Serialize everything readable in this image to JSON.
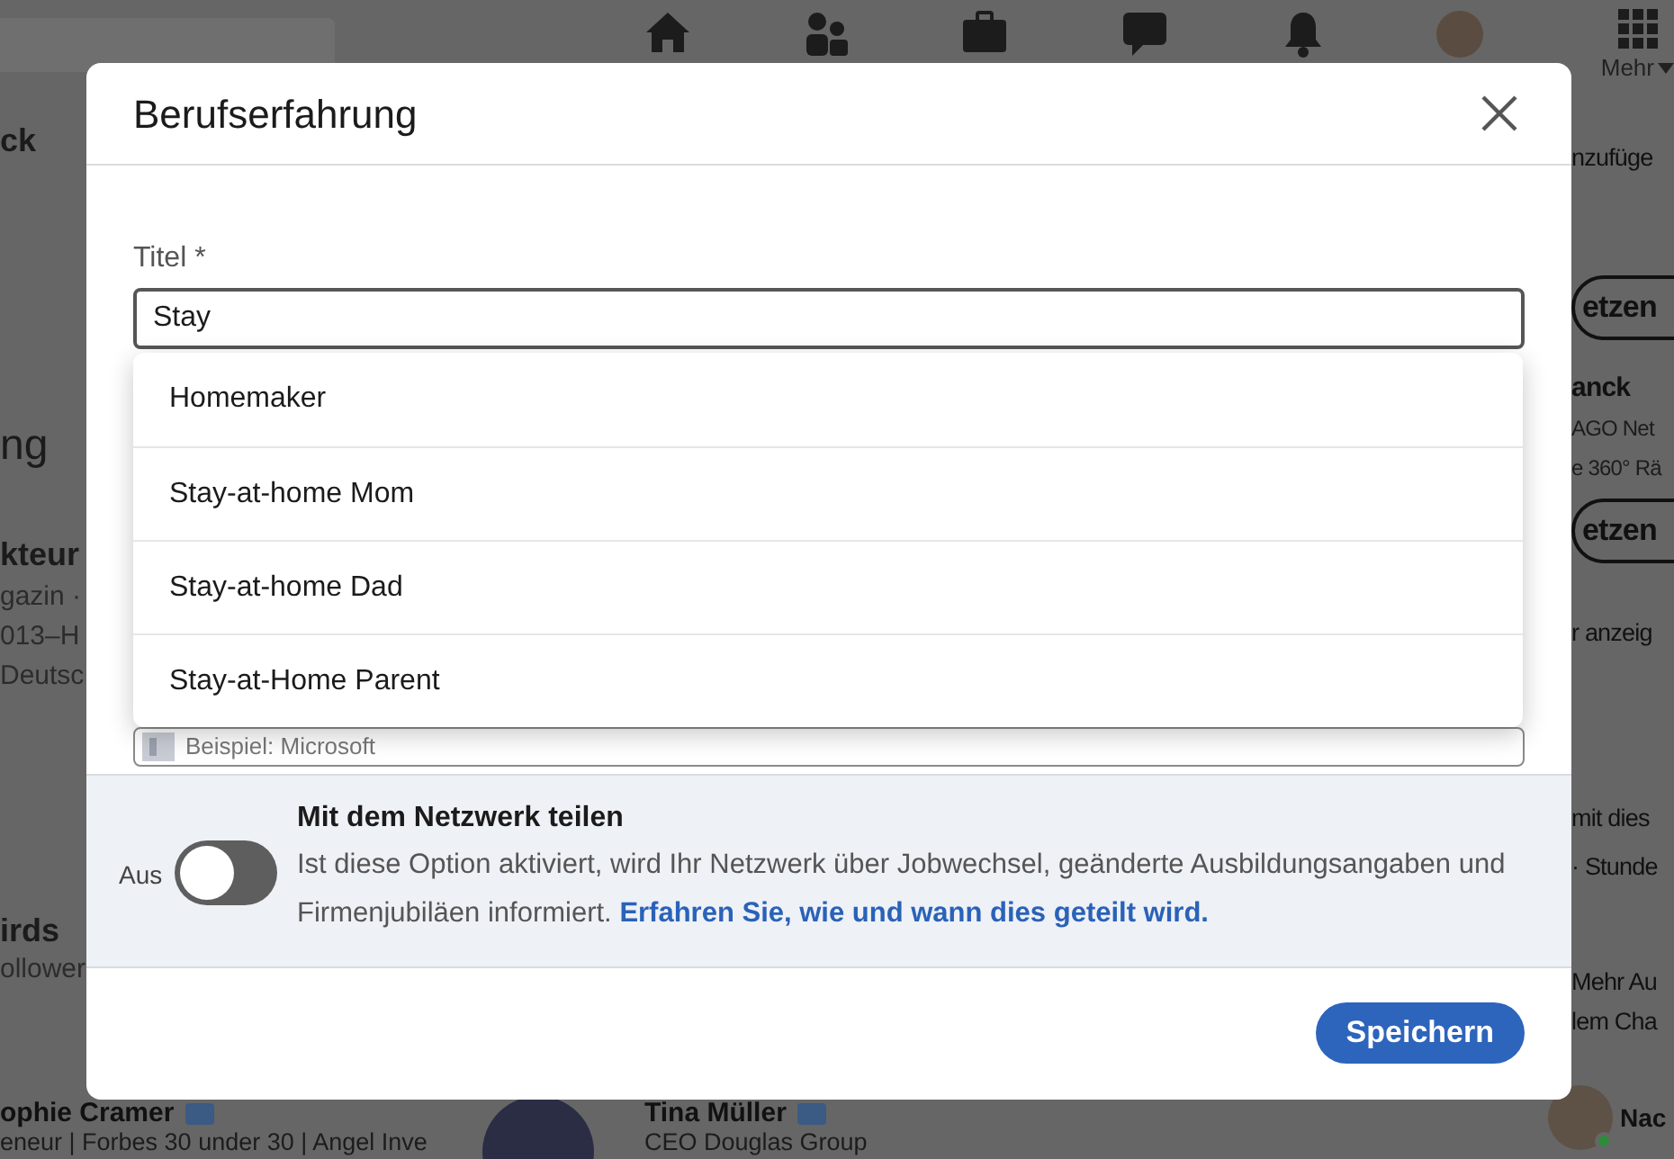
{
  "background": {
    "nav": {
      "more_label": "Mehr"
    },
    "left_column": [
      {
        "kind": "heading",
        "text": "ck"
      },
      {
        "kind": "large",
        "text": "ng"
      },
      {
        "kind": "heading",
        "text": "kteur"
      },
      {
        "kind": "sub",
        "text": "gazin ·"
      },
      {
        "kind": "sub",
        "text": "013–H"
      },
      {
        "kind": "sub",
        "text": "Deutsc"
      },
      {
        "kind": "heading",
        "text": "irds"
      },
      {
        "kind": "sub",
        "text": "ollower"
      }
    ],
    "right_column": [
      {
        "kind": "text",
        "text": "nzufüge"
      },
      {
        "kind": "button",
        "text": "etzen"
      },
      {
        "kind": "heading",
        "text": "anck"
      },
      {
        "kind": "sub",
        "text": "AGO Net"
      },
      {
        "kind": "sub",
        "text": "e 360° Rä"
      },
      {
        "kind": "button",
        "text": "etzen"
      },
      {
        "kind": "text",
        "text": "r anzeig"
      },
      {
        "kind": "text",
        "text": "mit dies"
      },
      {
        "kind": "text",
        "text": "· Stunde"
      },
      {
        "kind": "text",
        "text": "Mehr Au"
      },
      {
        "kind": "text",
        "text": "lem Cha"
      }
    ],
    "people": [
      {
        "name": "ophie Cramer",
        "headline": "eneur | Forbes 30 under 30 | Angel Inve"
      },
      {
        "name": "Tina Müller",
        "headline": "CEO Douglas Group"
      }
    ],
    "chat_contact": {
      "name": "Nac",
      "online": true
    }
  },
  "dialog": {
    "title": "Berufserfahrung",
    "title_field": {
      "label": "Titel *",
      "value": "Stay"
    },
    "suggestions": [
      "Homemaker",
      "Stay-at-home Mom",
      "Stay-at-home Dad",
      "Stay-at-Home Parent"
    ],
    "company_field": {
      "placeholder": "Beispiel: Microsoft"
    },
    "share": {
      "state_label": "Aus",
      "on": false,
      "title": "Mit dem Netzwerk teilen",
      "description": "Ist diese Option aktiviert, wird Ihr Netzwerk über Jobwechsel, geänderte Ausbildungsangaben und Firmenjubiläen informiert.",
      "link": "Erfahren Sie, wie und wann dies geteilt wird."
    },
    "save_button": "Speichern"
  }
}
